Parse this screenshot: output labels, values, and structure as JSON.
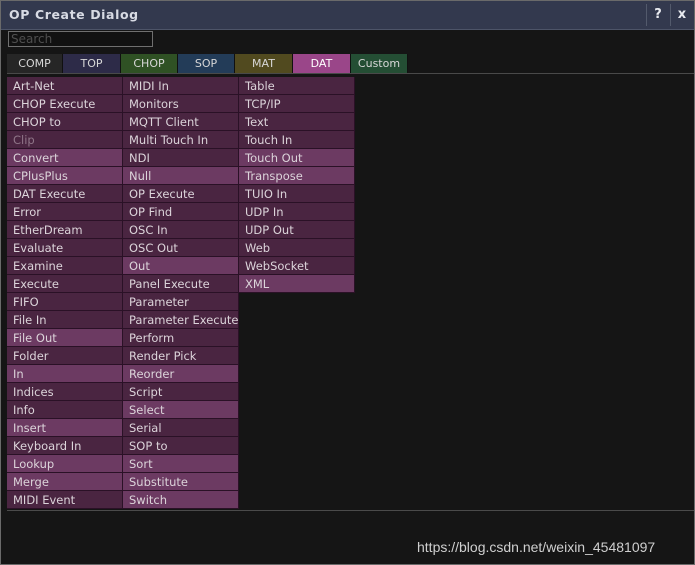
{
  "window": {
    "title": "OP Create Dialog",
    "help_label": "?",
    "close_label": "x"
  },
  "search": {
    "placeholder": "Search"
  },
  "tabs": [
    {
      "label": "COMP",
      "color": "#262626"
    },
    {
      "label": "TOP",
      "color": "#2d2b48"
    },
    {
      "label": "CHOP",
      "color": "#2f5124"
    },
    {
      "label": "SOP",
      "color": "#233c58"
    },
    {
      "label": "MAT",
      "color": "#514a1f"
    },
    {
      "label": "DAT",
      "color": "#9a4689"
    },
    {
      "label": "Custom",
      "color": "#244e34"
    }
  ],
  "columns": [
    [
      {
        "label": "Art-Net"
      },
      {
        "label": "CHOP Execute"
      },
      {
        "label": "CHOP to"
      },
      {
        "label": "Clip",
        "dim": true
      },
      {
        "label": "Convert",
        "hl": true
      },
      {
        "label": "CPlusPlus",
        "hl": true
      },
      {
        "label": "DAT Execute"
      },
      {
        "label": "Error"
      },
      {
        "label": "EtherDream"
      },
      {
        "label": "Evaluate"
      },
      {
        "label": "Examine"
      },
      {
        "label": "Execute"
      },
      {
        "label": "FIFO"
      },
      {
        "label": "File In"
      },
      {
        "label": "File Out",
        "hl": true
      },
      {
        "label": "Folder"
      },
      {
        "label": "In",
        "hl": true
      },
      {
        "label": "Indices"
      },
      {
        "label": "Info"
      },
      {
        "label": "Insert",
        "hl": true
      },
      {
        "label": "Keyboard In"
      },
      {
        "label": "Lookup",
        "hl": true
      },
      {
        "label": "Merge",
        "hl": true
      },
      {
        "label": "MIDI Event"
      }
    ],
    [
      {
        "label": "MIDI In"
      },
      {
        "label": "Monitors"
      },
      {
        "label": "MQTT Client"
      },
      {
        "label": "Multi Touch In"
      },
      {
        "label": "NDI"
      },
      {
        "label": "Null",
        "hl": true
      },
      {
        "label": "OP Execute"
      },
      {
        "label": "OP Find"
      },
      {
        "label": "OSC In"
      },
      {
        "label": "OSC Out"
      },
      {
        "label": "Out",
        "hl": true
      },
      {
        "label": "Panel Execute"
      },
      {
        "label": "Parameter"
      },
      {
        "label": "Parameter Execute"
      },
      {
        "label": "Perform"
      },
      {
        "label": "Render Pick"
      },
      {
        "label": "Reorder",
        "hl": true
      },
      {
        "label": "Script"
      },
      {
        "label": "Select",
        "hl": true
      },
      {
        "label": "Serial"
      },
      {
        "label": "SOP to"
      },
      {
        "label": "Sort",
        "hl": true
      },
      {
        "label": "Substitute",
        "hl": true
      },
      {
        "label": "Switch",
        "hl": true
      }
    ],
    [
      {
        "label": "Table"
      },
      {
        "label": "TCP/IP"
      },
      {
        "label": "Text"
      },
      {
        "label": "Touch In"
      },
      {
        "label": "Touch Out",
        "hl": true
      },
      {
        "label": "Transpose",
        "hl": true
      },
      {
        "label": "TUIO In"
      },
      {
        "label": "UDP In"
      },
      {
        "label": "UDP Out"
      },
      {
        "label": "Web"
      },
      {
        "label": "WebSocket"
      },
      {
        "label": "XML",
        "hl": true
      }
    ]
  ],
  "watermark": "https://blog.csdn.net/weixin_45481097"
}
